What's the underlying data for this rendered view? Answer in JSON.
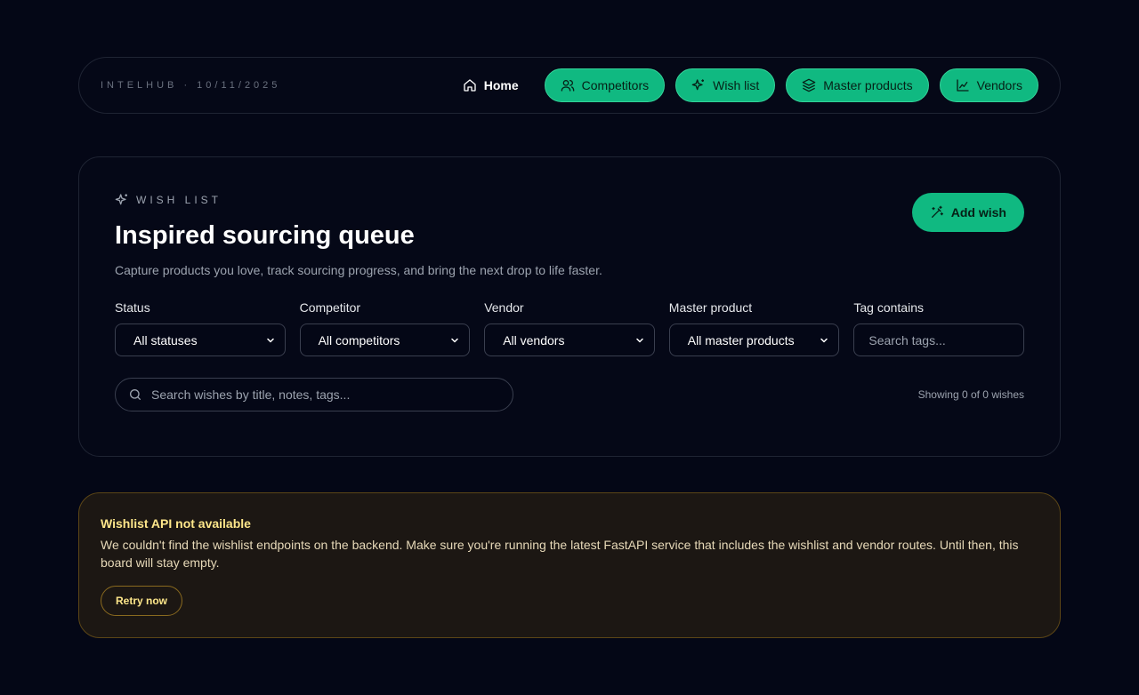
{
  "nav": {
    "brand": "INTELHUB · 10/11/2025",
    "home": "Home",
    "links": [
      {
        "label": "Competitors",
        "icon": "users-icon"
      },
      {
        "label": "Wish list",
        "icon": "sparkles-icon"
      },
      {
        "label": "Master products",
        "icon": "layers-icon"
      },
      {
        "label": "Vendors",
        "icon": "chart-icon"
      }
    ]
  },
  "wishlist": {
    "eyebrow": "WISH LIST",
    "title": "Inspired sourcing queue",
    "subtitle": "Capture products you love, track sourcing progress, and bring the next drop to life faster.",
    "add_button": "Add wish",
    "filters": {
      "status": {
        "label": "Status",
        "value": "All statuses"
      },
      "competitor": {
        "label": "Competitor",
        "value": "All competitors"
      },
      "vendor": {
        "label": "Vendor",
        "value": "All vendors"
      },
      "master": {
        "label": "Master product",
        "value": "All master products"
      },
      "tag": {
        "label": "Tag contains",
        "placeholder": "Search tags..."
      }
    },
    "search_placeholder": "Search wishes by title, notes, tags...",
    "count": "Showing 0 of 0 wishes"
  },
  "alert": {
    "title": "Wishlist API not available",
    "body": "We couldn't find the wishlist endpoints on the backend. Make sure you're running the latest FastAPI service that includes the wishlist and vendor routes. Until then, this board will stay empty.",
    "retry": "Retry now"
  },
  "colors": {
    "background": "#040716",
    "accent": "#10b981",
    "warning": "#fde68a"
  }
}
